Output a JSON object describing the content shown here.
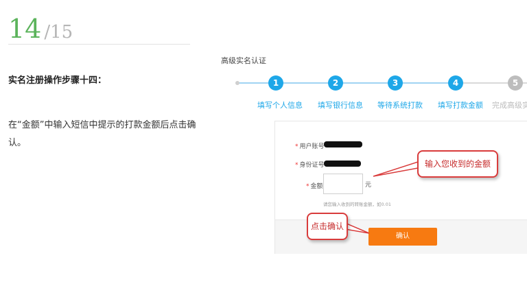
{
  "step": {
    "current": "14",
    "total": "/15"
  },
  "left": {
    "title": "实名注册操作步骤十四：",
    "description": "在“金额”中输入短信中提示的打款金额后点击确认。"
  },
  "shot": {
    "title": "高级实名认证",
    "steps": [
      {
        "num": "1",
        "label": "填写个人信息"
      },
      {
        "num": "2",
        "label": "填写银行信息"
      },
      {
        "num": "3",
        "label": "等待系统打款"
      },
      {
        "num": "4",
        "label": "填写打款金额"
      },
      {
        "num": "5",
        "label": "完成高级实名"
      }
    ],
    "form": {
      "account_label": "用户账号",
      "id_label": "身份证号",
      "amount_label": "金额",
      "amount_unit": "元",
      "hint": "请您输入收到的转账金额，如0.01",
      "required_mark": "*",
      "confirm": "确认"
    },
    "callouts": {
      "amount": "输入您收到的金额",
      "confirm": "点击确认"
    }
  },
  "colors": {
    "step_green": "#5bb35b",
    "accent_blue": "#1ea7e8",
    "button_orange": "#f77a11",
    "callout_red": "#d93b3b"
  }
}
